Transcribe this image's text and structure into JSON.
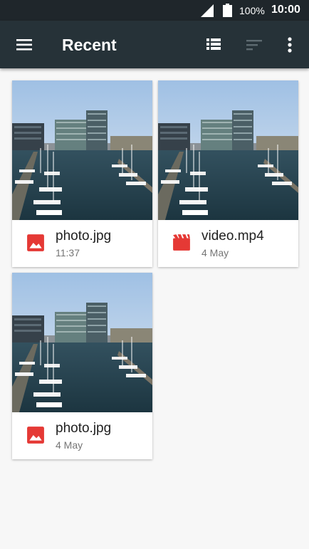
{
  "status_bar": {
    "battery_percent": "100%",
    "time": "10:00",
    "icons": [
      "signal-icon",
      "battery-icon"
    ]
  },
  "app_bar": {
    "title": "Recent",
    "icons": [
      "menu-icon",
      "list-view-icon",
      "sort-icon",
      "more-vert-icon"
    ]
  },
  "files": [
    {
      "name": "photo.jpg",
      "date": "11:37",
      "type": "image",
      "icon": "image-icon"
    },
    {
      "name": "video.mp4",
      "date": "4 May",
      "type": "video",
      "icon": "movie-icon"
    },
    {
      "name": "photo.jpg",
      "date": "4 May",
      "type": "image",
      "icon": "image-icon"
    }
  ],
  "colors": {
    "status_bar": "#1f262b",
    "app_bar": "#263238",
    "background": "#f7f7f7",
    "file_icon_red": "#e53935"
  }
}
